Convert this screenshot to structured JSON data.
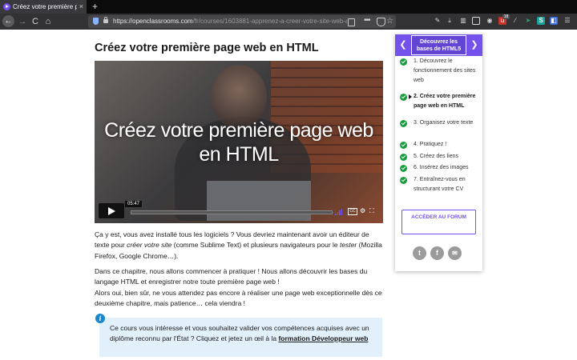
{
  "browser": {
    "tab_title": "Créez votre première page web",
    "tab_close": "×",
    "new_tab": "+",
    "back": "←",
    "forward": "→",
    "reload": "C",
    "home": "⌂",
    "url_host": "https://openclassrooms.com",
    "url_path": "/fr/courses/1603881-apprenez-a-creer-votre-site-web-avec-h",
    "page_actions": "•••",
    "bookmark_star": "☆",
    "notification_count": "18"
  },
  "page": {
    "title": "Créez votre première page web en HTML",
    "video": {
      "title": "Créez votre première page web en HTML",
      "duration": "05:47",
      "progress": 0,
      "cc": "CC",
      "settings_icon": "⚙",
      "fullscreen_icon": "⛶"
    },
    "paragraph1": {
      "a": "Ça y est, vous avez installé tous les logiciels ? Vous devriez maintenant avoir un éditeur de texte pour ",
      "a_em": "créer votre site",
      "b": " (comme Sublime Text) et plusieurs navigateurs pour le ",
      "b_em": "tester",
      "c": " (Mozilla Firefox, Google Chrome…)."
    },
    "paragraph2": {
      "line1": "Dans ce chapitre, nous allons commencer à pratiquer ! Nous allons découvrir les bases du langage HTML et enregistrer notre toute première page web !",
      "line2": "Alors oui, bien sûr, ne vous attendez pas encore à réaliser une page web exceptionnelle dès ce deuxième chapitre, mais patience… cela viendra !"
    },
    "info": {
      "icon": "i",
      "text": "Ce cours vous intéresse et vous souhaitez valider vos compétences acquises avec un diplôme reconnu par l'État ? Cliquez et jetez un œil à la ",
      "link": "formation Développeur web"
    }
  },
  "sidebar": {
    "prev": "❮",
    "next": "❯",
    "part_title": "Découvrez les bases de HTML5",
    "chapters": [
      {
        "label": "1. Découvrez le fonctionnement des sites web",
        "done": true
      },
      {
        "label": "2. Créez votre première page web en HTML",
        "done": true,
        "current": true
      },
      {
        "label": "3. Organisez votre texte",
        "done": true
      },
      {
        "label": "4. Pratiquez !",
        "done": true
      },
      {
        "label": "5. Créez des liens",
        "done": true
      },
      {
        "label": "6. Insérez des images",
        "done": true
      },
      {
        "label": "7. Entraînez-vous en structurant votre CV",
        "done": true
      }
    ],
    "forum_button": "ACCÉDER AU FORUM",
    "social": {
      "twitter": "t",
      "facebook": "f",
      "email": "✉"
    }
  }
}
